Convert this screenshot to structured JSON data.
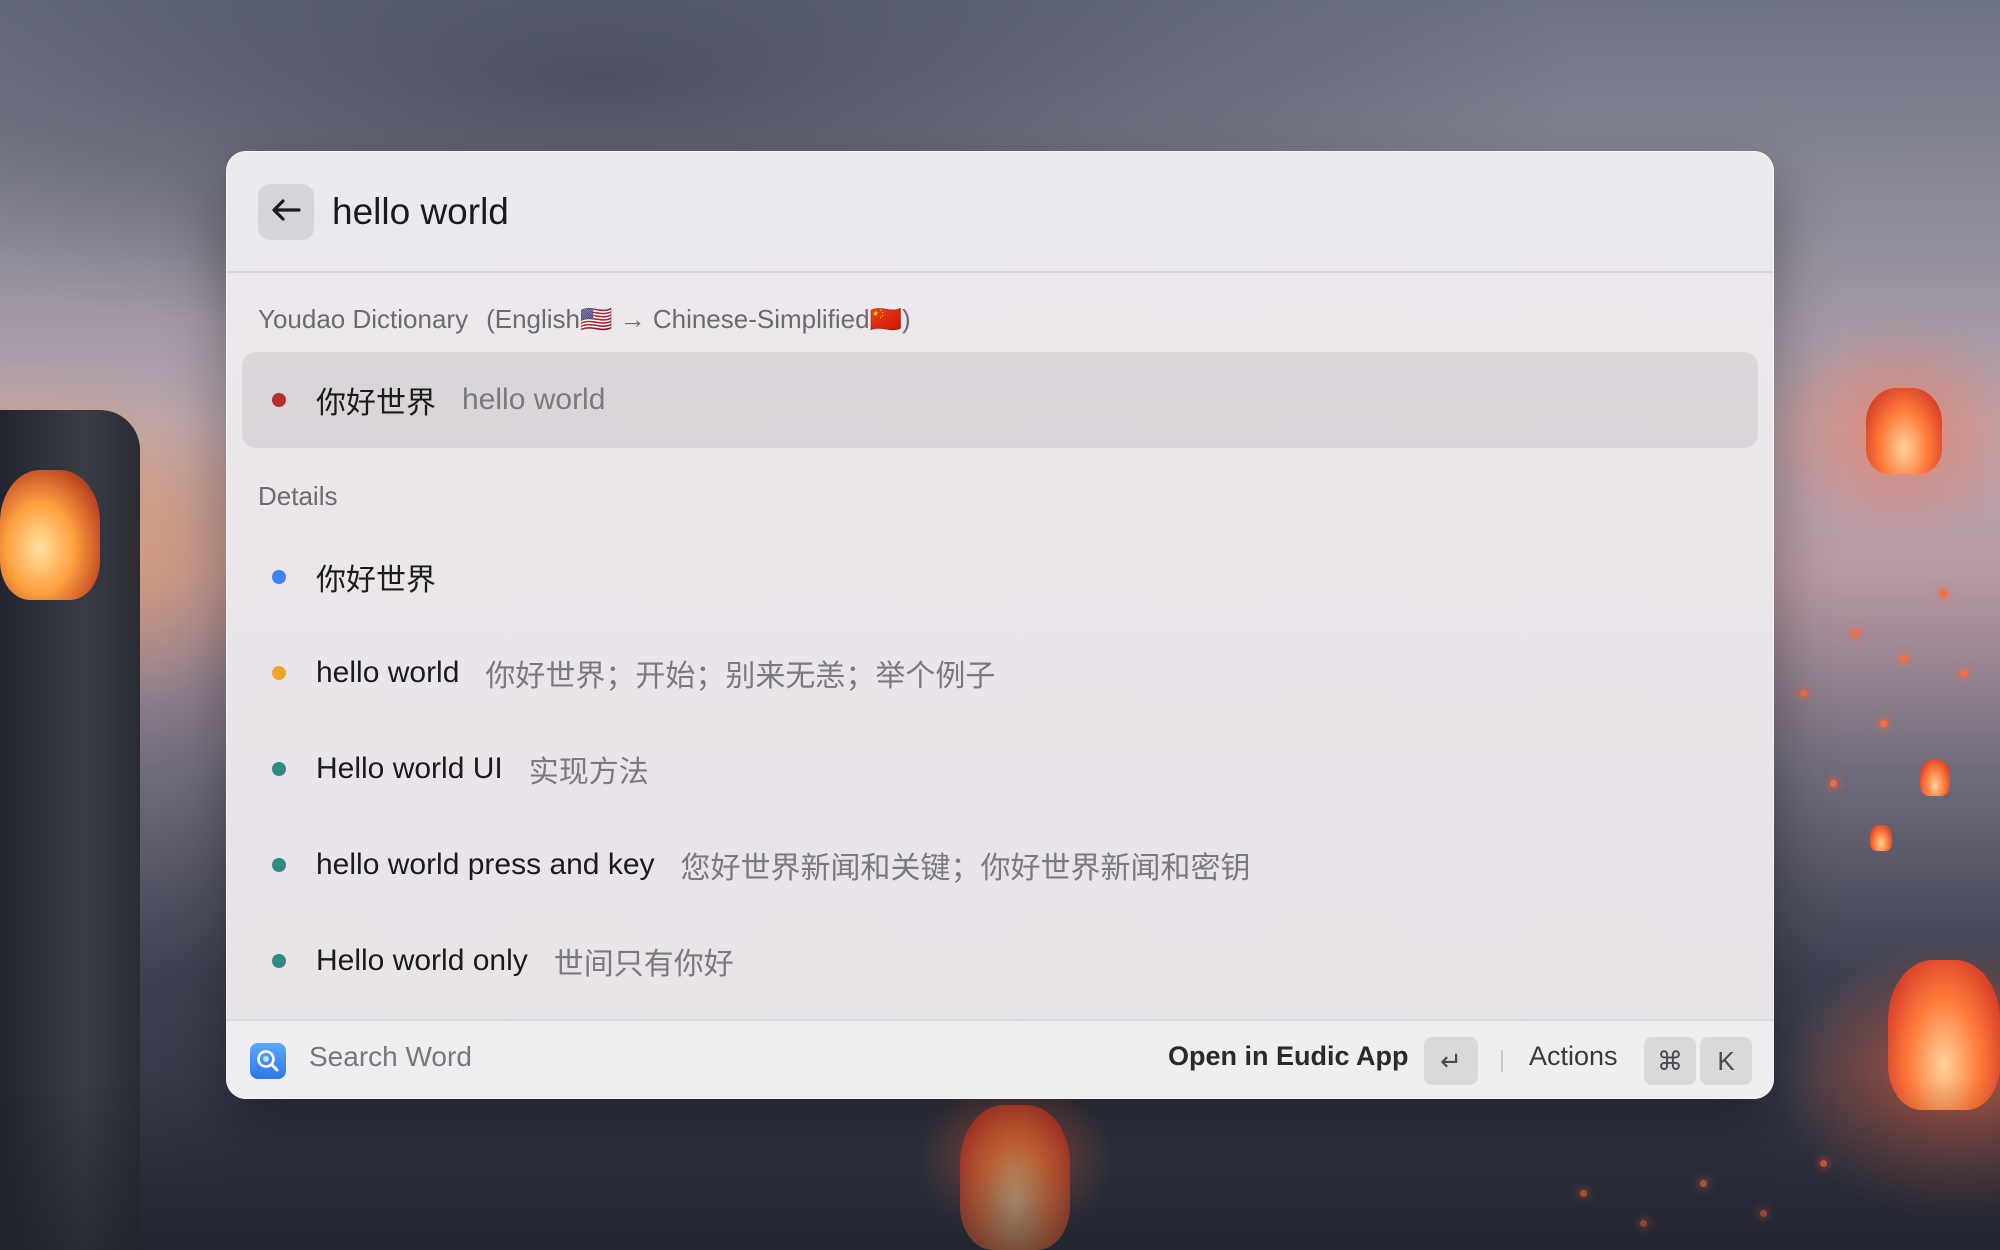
{
  "search": {
    "query": "hello world"
  },
  "sections": {
    "dictionary": {
      "title": "Youdao Dictionary",
      "subtitle": "(English🇺🇸 → Chinese-Simplified🇨🇳)"
    },
    "details": {
      "title": "Details"
    }
  },
  "results": [
    {
      "title": "你好世界",
      "subtitle": "hello world",
      "dot_color": "#b3322c"
    }
  ],
  "details": [
    {
      "title": "你好世界",
      "subtitle": "",
      "dot_color": "#3b82f6"
    },
    {
      "title": "hello world",
      "subtitle": "你好世界；开始；别来无恙；举个例子",
      "dot_color": "#f0a529"
    },
    {
      "title": "Hello world UI",
      "subtitle": "实现方法",
      "dot_color": "#2e8b82"
    },
    {
      "title": "hello world press and key",
      "subtitle": "您好世界新闻和关键；你好世界新闻和密钥",
      "dot_color": "#2e8b82"
    },
    {
      "title": "Hello world only",
      "subtitle": "世间只有你好",
      "dot_color": "#2e8b82"
    }
  ],
  "footer": {
    "command_title": "Search Word",
    "primary_action": "Open in Eudic App",
    "primary_shortcut": "↵",
    "actions_label": "Actions",
    "actions_shortcut": [
      "⌘",
      "K"
    ]
  },
  "icons": {
    "back": "arrow-left-icon",
    "app": "eudic-app-icon"
  }
}
